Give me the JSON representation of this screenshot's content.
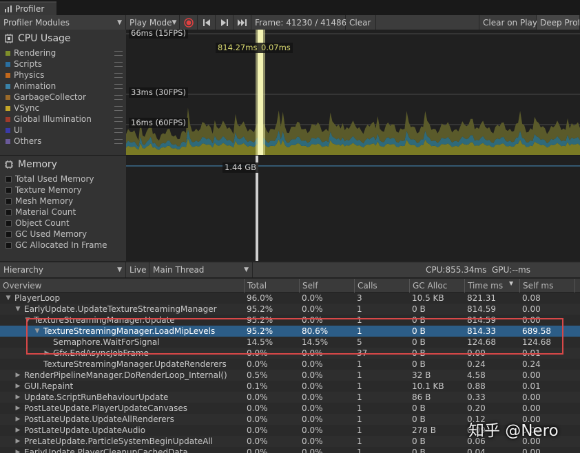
{
  "window": {
    "tab_title": "Profiler"
  },
  "toolbar": {
    "modules_label": "Profiler Modules",
    "play_mode_label": "Play Mode",
    "frame_label": "Frame: 41230 / 41486",
    "clear_label": "Clear",
    "clear_on_play_label": "Clear on Play",
    "deep_profile_label": "Deep Profi"
  },
  "cpu_module": {
    "title": "CPU Usage",
    "legend": [
      {
        "label": "Rendering",
        "color": "#7f8f2a"
      },
      {
        "label": "Scripts",
        "color": "#2a6fa0"
      },
      {
        "label": "Physics",
        "color": "#c2681c"
      },
      {
        "label": "Animation",
        "color": "#3a82a8"
      },
      {
        "label": "GarbageCollector",
        "color": "#9a6a2a"
      },
      {
        "label": "VSync",
        "color": "#c4a628"
      },
      {
        "label": "Global Illumination",
        "color": "#a03a2a"
      },
      {
        "label": "UI",
        "color": "#3a3aa8"
      },
      {
        "label": "Others",
        "color": "#6a5a9a"
      }
    ],
    "markers": {
      "ms66": "66ms (15FPS)",
      "ms33": "33ms (30FPS)",
      "ms16": "16ms (60FPS)"
    },
    "tooltip_main": "814.27ms",
    "tooltip_small": "0.07ms"
  },
  "memory_module": {
    "title": "Memory",
    "legend": [
      "Total Used Memory",
      "Texture Memory",
      "Mesh Memory",
      "Material Count",
      "Object Count",
      "GC Used Memory",
      "GC Allocated In Frame"
    ],
    "value_label": "1.44 GB"
  },
  "hierarchy_bar": {
    "view_label": "Hierarchy",
    "live_label": "Live",
    "thread_label": "Main Thread",
    "cpu_gpu": "CPU:855.34ms  GPU:--ms"
  },
  "columns": [
    "Overview",
    "Total",
    "Self",
    "Calls",
    "GC Alloc",
    "Time ms",
    "Self ms"
  ],
  "rows": [
    {
      "name": "PlayerLoop",
      "total": "96.0%",
      "self": "0.0%",
      "calls": "3",
      "gc": "10.5 KB",
      "time": "821.31",
      "selfms": "0.08"
    },
    {
      "name": "EarlyUpdate.UpdateTextureStreamingManager",
      "total": "95.2%",
      "self": "0.0%",
      "calls": "1",
      "gc": "0 B",
      "time": "814.59",
      "selfms": "0.00"
    },
    {
      "name": "TextureStreamingManager.Update",
      "total": "95.2%",
      "self": "0.0%",
      "calls": "1",
      "gc": "0 B",
      "time": "814.59",
      "selfms": "0.00"
    },
    {
      "name": "TextureStreamingManager.LoadMipLevels",
      "total": "95.2%",
      "self": "80.6%",
      "calls": "1",
      "gc": "0 B",
      "time": "814.33",
      "selfms": "689.58"
    },
    {
      "name": "Semaphore.WaitForSignal",
      "total": "14.5%",
      "self": "14.5%",
      "calls": "5",
      "gc": "0 B",
      "time": "124.68",
      "selfms": "124.68"
    },
    {
      "name": "Gfx.EndAsyncJobFrame",
      "total": "0.0%",
      "self": "0.0%",
      "calls": "37",
      "gc": "0 B",
      "time": "0.00",
      "selfms": "0.01"
    },
    {
      "name": "TextureStreamingManager.UpdateRenderers",
      "total": "0.0%",
      "self": "0.0%",
      "calls": "1",
      "gc": "0 B",
      "time": "0.24",
      "selfms": "0.24"
    },
    {
      "name": "RenderPipelineManager.DoRenderLoop_Internal()",
      "total": "0.5%",
      "self": "0.0%",
      "calls": "1",
      "gc": "32 B",
      "time": "4.58",
      "selfms": "0.00"
    },
    {
      "name": "GUI.Repaint",
      "total": "0.1%",
      "self": "0.0%",
      "calls": "1",
      "gc": "10.1 KB",
      "time": "0.88",
      "selfms": "0.01"
    },
    {
      "name": "Update.ScriptRunBehaviourUpdate",
      "total": "0.0%",
      "self": "0.0%",
      "calls": "1",
      "gc": "86 B",
      "time": "0.33",
      "selfms": "0.00"
    },
    {
      "name": "PostLateUpdate.PlayerUpdateCanvases",
      "total": "0.0%",
      "self": "0.0%",
      "calls": "1",
      "gc": "0 B",
      "time": "0.20",
      "selfms": "0.00"
    },
    {
      "name": "PostLateUpdate.UpdateAllRenderers",
      "total": "0.0%",
      "self": "0.0%",
      "calls": "1",
      "gc": "0 B",
      "time": "0.12",
      "selfms": "0.00"
    },
    {
      "name": "PostLateUpdate.UpdateAudio",
      "total": "0.0%",
      "self": "0.0%",
      "calls": "1",
      "gc": "278 B",
      "time": "0.09",
      "selfms": "0.00"
    },
    {
      "name": "PreLateUpdate.ParticleSystemBeginUpdateAll",
      "total": "0.0%",
      "self": "0.0%",
      "calls": "1",
      "gc": "0 B",
      "time": "0.06",
      "selfms": "0.00"
    },
    {
      "name": "EarlyUpdate.PlayerCleanupCachedData",
      "total": "0.0%",
      "self": "0.0%",
      "calls": "1",
      "gc": "0 B",
      "time": "0.04",
      "selfms": "0.00"
    }
  ],
  "watermark": "知乎 @Nero"
}
